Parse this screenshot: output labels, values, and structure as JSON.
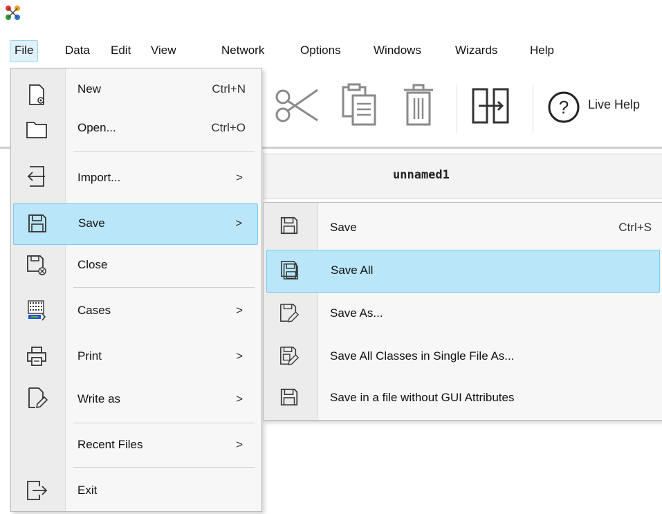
{
  "app": {
    "logo_icon": "network-nodes-logo-icon"
  },
  "menubar": {
    "items": [
      "File",
      "Data",
      "Edit",
      "View",
      "Network",
      "Options",
      "Windows",
      "Wizards",
      "Help"
    ]
  },
  "toolbar": {
    "live_help_label": "Live Help",
    "icons": [
      "new-file-icon",
      "open-folder-icon",
      "save-icon",
      "cut-icon",
      "copy-icon",
      "delete-icon",
      "split-window-icon",
      "help-icon"
    ]
  },
  "document": {
    "title": "unnamed1"
  },
  "file_menu": {
    "items": [
      {
        "label": "New",
        "shortcut": "Ctrl+N",
        "icon": "new-file-icon"
      },
      {
        "label": "Open...",
        "shortcut": "Ctrl+O",
        "icon": "open-folder-icon"
      },
      {
        "label": "Import...",
        "arrow": ">",
        "icon": "import-icon"
      },
      {
        "label": "Save",
        "arrow": ">",
        "icon": "save-icon"
      },
      {
        "label": "Close",
        "icon": "close-file-icon"
      },
      {
        "label": "Cases",
        "arrow": ">",
        "icon": "cases-icon"
      },
      {
        "label": "Print",
        "arrow": ">",
        "icon": "printer-icon"
      },
      {
        "label": "Write as",
        "arrow": ">",
        "icon": "write-as-icon"
      },
      {
        "label": "Recent Files",
        "arrow": ">"
      },
      {
        "label": "Exit",
        "icon": "exit-icon"
      }
    ]
  },
  "save_submenu": {
    "items": [
      {
        "label": "Save",
        "shortcut": "Ctrl+S",
        "icon": "save-icon"
      },
      {
        "label": "Save All",
        "icon": "save-all-icon"
      },
      {
        "label": "Save As...",
        "icon": "save-as-icon"
      },
      {
        "label": "Save All Classes in Single File As...",
        "icon": "save-classes-icon"
      },
      {
        "label": "Save in a file without GUI Attributes",
        "icon": "save-no-gui-icon"
      }
    ]
  },
  "colors": {
    "highlight": "#b9e6f8",
    "highlight_border": "#7ccbed"
  }
}
